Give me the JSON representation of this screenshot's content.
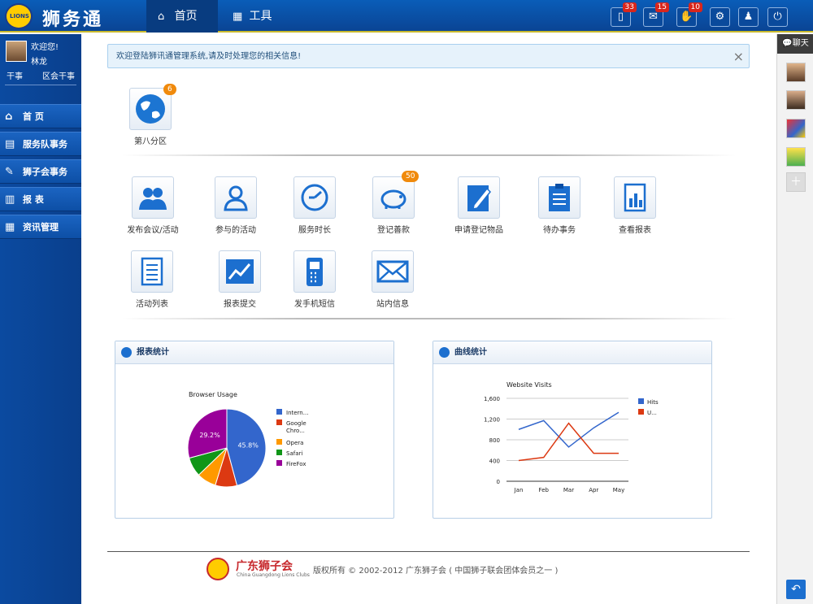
{
  "header": {
    "logo_text": "LIONS",
    "app_title": "狮务通",
    "nav": [
      {
        "label": "首页",
        "icon": "home-icon"
      },
      {
        "label": "工具",
        "icon": "keyboard-icon"
      }
    ],
    "icons": [
      {
        "name": "mobile-icon",
        "badge": "33"
      },
      {
        "name": "mail-icon",
        "badge": "15"
      },
      {
        "name": "hand-icon",
        "badge": "10"
      },
      {
        "name": "gear-icon",
        "badge": ""
      },
      {
        "name": "user-icon",
        "badge": ""
      },
      {
        "name": "power-icon",
        "badge": ""
      }
    ]
  },
  "user": {
    "welcome": "欢迎您!",
    "name": "林龙",
    "role1": "干事",
    "role2": "区会干事"
  },
  "sidebar": {
    "items": [
      {
        "label": "首 页",
        "icon": "home-icon"
      },
      {
        "label": "服务队事务",
        "icon": "clipboard-icon"
      },
      {
        "label": "狮子会事务",
        "icon": "edit-icon"
      },
      {
        "label": "报 表",
        "icon": "document-icon"
      },
      {
        "label": "资讯管理",
        "icon": "calendar-icon"
      }
    ]
  },
  "notice": {
    "text": "欢迎登陆狮讯通管理系统,请及时处理您的相关信息!",
    "close": "×"
  },
  "district": {
    "label": "第八分区",
    "badge": "6"
  },
  "tiles": [
    {
      "label": "发布会议/活动",
      "icon": "people-icon",
      "badge": ""
    },
    {
      "label": "参与的活动",
      "icon": "person-icon",
      "badge": ""
    },
    {
      "label": "服务时长",
      "icon": "clock-icon",
      "badge": ""
    },
    {
      "label": "登记善款",
      "icon": "piggy-bank-icon",
      "badge": "50"
    },
    {
      "label": "申请登记物品",
      "icon": "notepad-icon",
      "badge": ""
    },
    {
      "label": "待办事务",
      "icon": "clipboard-list-icon",
      "badge": ""
    },
    {
      "label": "查看报表",
      "icon": "bar-report-icon",
      "badge": ""
    },
    {
      "label": "活动列表",
      "icon": "list-icon",
      "badge": ""
    },
    {
      "label": "报表提交",
      "icon": "trend-icon",
      "badge": ""
    },
    {
      "label": "发手机短信",
      "icon": "phone-icon",
      "badge": ""
    },
    {
      "label": "站内信息",
      "icon": "envelope-icon",
      "badge": ""
    }
  ],
  "panels": {
    "pie_title": "报表统计",
    "line_title": "曲线统计"
  },
  "chart_data": [
    {
      "type": "pie",
      "title": "Browser Usage",
      "labels": [
        "Intern...",
        "Google Chro...",
        "Opera",
        "Safari",
        "FireFox"
      ],
      "values": [
        45.8,
        9.0,
        8.0,
        8.0,
        29.2
      ],
      "slice_labels": [
        "45.8%",
        "",
        "",
        "",
        "29.2%"
      ],
      "colors": [
        "#3366cc",
        "#dc3912",
        "#ff9900",
        "#109618",
        "#990099"
      ],
      "legend": "right"
    },
    {
      "type": "line",
      "title": "Website Visits",
      "categories": [
        "Jan",
        "Feb",
        "Mar",
        "Apr",
        "May"
      ],
      "series": [
        {
          "name": "Hits",
          "values": [
            1000,
            1170,
            660,
            1030,
            1330
          ],
          "color": "#3366cc"
        },
        {
          "name": "U...",
          "values": [
            400,
            460,
            1120,
            540,
            540
          ],
          "color": "#dc3912"
        }
      ],
      "ylim": [
        0,
        1600
      ],
      "yticks": [
        "1,600",
        "1,200",
        "800",
        "400",
        "0"
      ],
      "grid": true,
      "legend": "right"
    }
  ],
  "chat": {
    "label": "聊天"
  },
  "footer": {
    "org": "广东狮子会",
    "org_en": "China Guangdong Lions Clubs",
    "copyright": "版权所有 © 2002-2012 广东狮子会 ( 中国狮子联会团体会员之一 )"
  }
}
